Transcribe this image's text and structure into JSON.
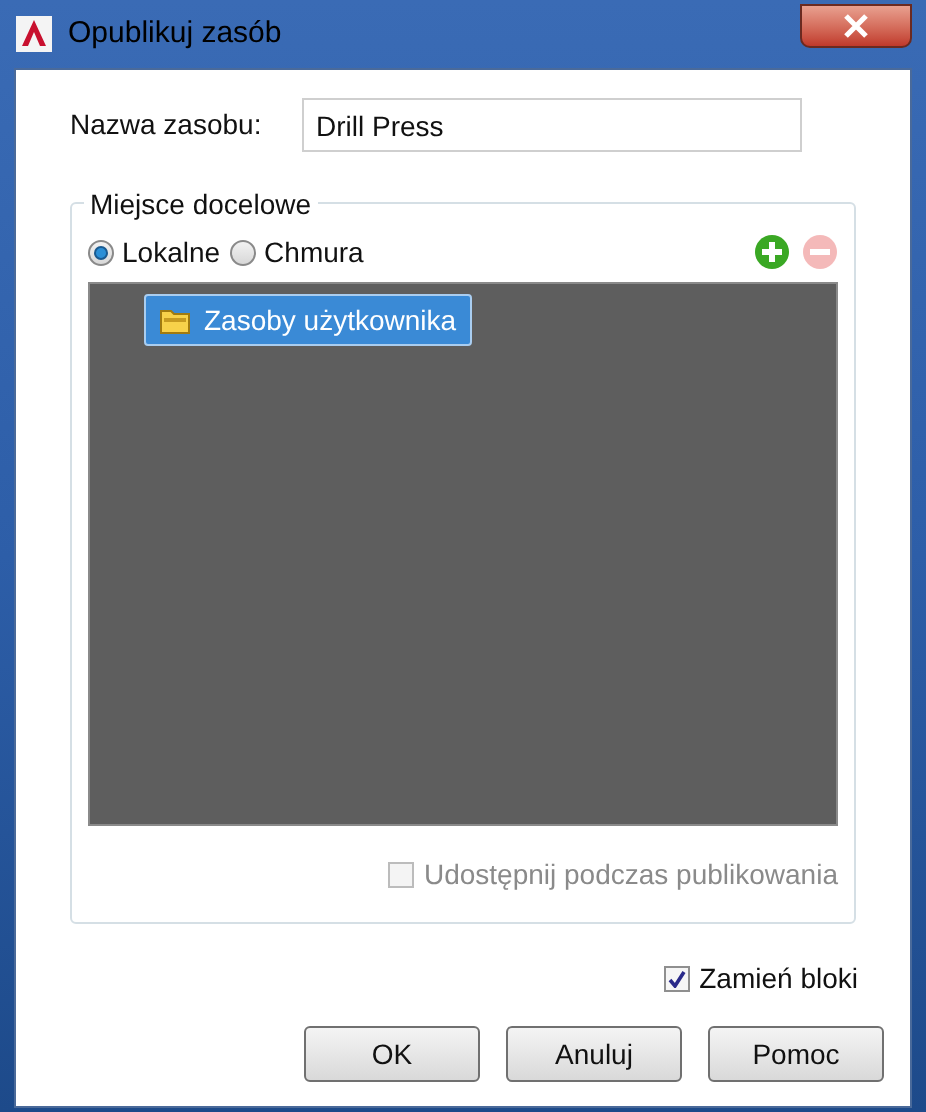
{
  "window": {
    "title": "Opublikuj zasób"
  },
  "name_field": {
    "label": "Nazwa zasobu:",
    "value": "Drill Press"
  },
  "destination": {
    "title": "Miejsce docelowe",
    "options": [
      {
        "label": "Lokalne",
        "selected": true
      },
      {
        "label": "Chmura",
        "selected": false
      }
    ],
    "add_disabled": false,
    "remove_disabled": true,
    "tree": [
      {
        "label": "Zasoby użytkownika",
        "selected": true
      }
    ],
    "share": {
      "label": "Udostępnij podczas publikowania",
      "checked": false,
      "disabled": true
    }
  },
  "replace_blocks": {
    "label": "Zamień bloki",
    "checked": true
  },
  "buttons": [
    "OK",
    "Anuluj",
    "Pomoc"
  ]
}
